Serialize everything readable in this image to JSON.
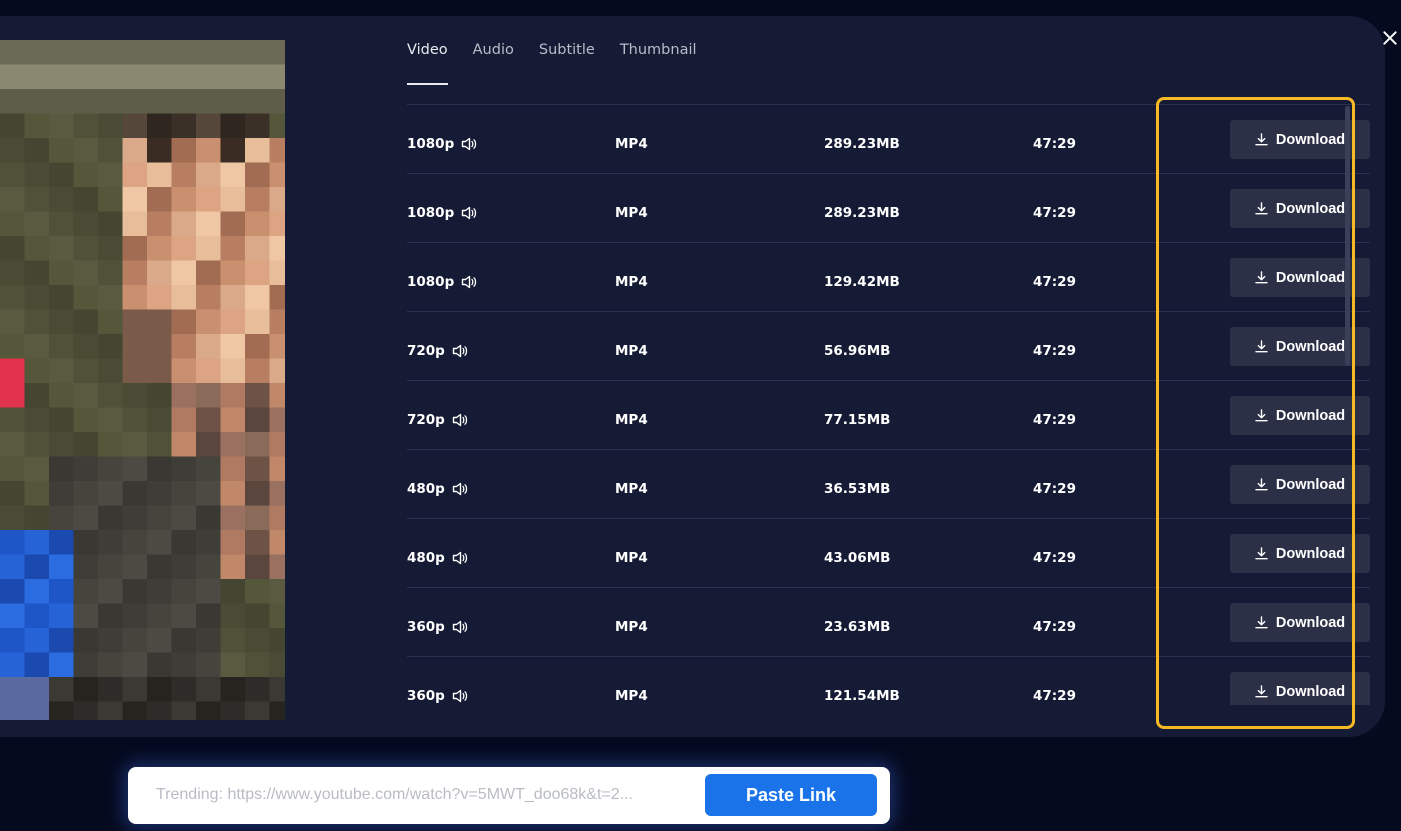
{
  "tabs": [
    {
      "label": "Video",
      "active": true
    },
    {
      "label": "Audio",
      "active": false
    },
    {
      "label": "Subtitle",
      "active": false
    },
    {
      "label": "Thumbnail",
      "active": false
    }
  ],
  "rows": [
    {
      "quality": "1080p",
      "format": "MP4",
      "size": "289.23MB",
      "duration": "47:29",
      "action": "Download"
    },
    {
      "quality": "1080p",
      "format": "MP4",
      "size": "289.23MB",
      "duration": "47:29",
      "action": "Download"
    },
    {
      "quality": "1080p",
      "format": "MP4",
      "size": "129.42MB",
      "duration": "47:29",
      "action": "Download"
    },
    {
      "quality": "720p",
      "format": "MP4",
      "size": "56.96MB",
      "duration": "47:29",
      "action": "Download"
    },
    {
      "quality": "720p",
      "format": "MP4",
      "size": "77.15MB",
      "duration": "47:29",
      "action": "Download"
    },
    {
      "quality": "480p",
      "format": "MP4",
      "size": "36.53MB",
      "duration": "47:29",
      "action": "Download"
    },
    {
      "quality": "480p",
      "format": "MP4",
      "size": "43.06MB",
      "duration": "47:29",
      "action": "Download"
    },
    {
      "quality": "360p",
      "format": "MP4",
      "size": "23.63MB",
      "duration": "47:29",
      "action": "Download"
    },
    {
      "quality": "360p",
      "format": "MP4",
      "size": "121.54MB",
      "duration": "47:29",
      "action": "Download"
    }
  ],
  "icons": {
    "close": "close-icon",
    "download": "download-icon",
    "audio": "speaker-icon"
  },
  "colors": {
    "accent": "#1a73e8",
    "highlight": "#f7b924",
    "panel": "#151b35"
  },
  "search": {
    "placeholder": "Trending: https://www.youtube.com/watch?v=5MWT_doo68k&t=2...",
    "button_label": "Paste Link"
  }
}
